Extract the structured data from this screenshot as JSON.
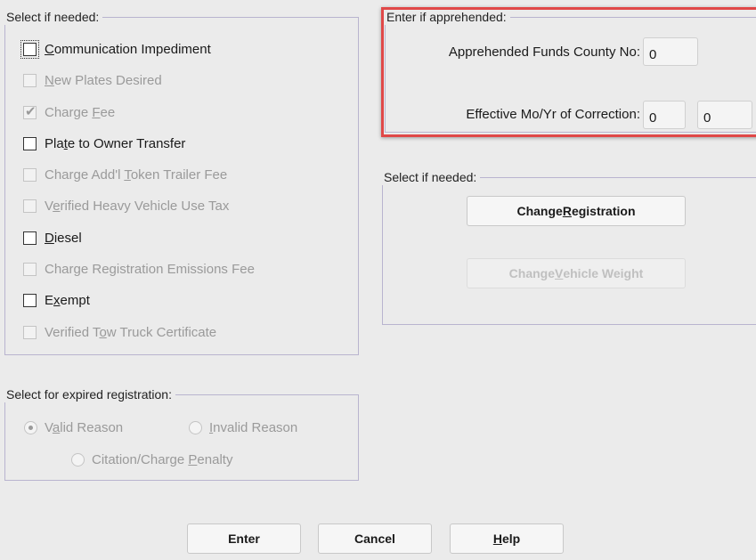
{
  "select_group": {
    "legend": "Select if needed:",
    "items": [
      {
        "pre": "",
        "mn": "C",
        "post": "ommunication Impediment",
        "checked": false,
        "disabled": false
      },
      {
        "pre": "",
        "mn": "N",
        "post": "ew Plates Desired",
        "checked": false,
        "disabled": true
      },
      {
        "pre": "Charge ",
        "mn": "F",
        "post": "ee",
        "checked": true,
        "disabled": true
      },
      {
        "pre": "Pla",
        "mn": "t",
        "post": "e to Owner Transfer",
        "checked": false,
        "disabled": false
      },
      {
        "pre": "Charge Add'l ",
        "mn": "T",
        "post": "oken Trailer Fee",
        "checked": false,
        "disabled": true
      },
      {
        "pre": "V",
        "mn": "e",
        "post": "rified Heavy Vehicle Use Tax",
        "checked": false,
        "disabled": true
      },
      {
        "pre": "",
        "mn": "D",
        "post": "iesel",
        "checked": false,
        "disabled": false
      },
      {
        "pre": "Char",
        "mn": "g",
        "post": "e Registration Emissions Fee",
        "checked": false,
        "disabled": true
      },
      {
        "pre": "E",
        "mn": "x",
        "post": "empt",
        "checked": false,
        "disabled": false
      },
      {
        "pre": "Verified T",
        "mn": "o",
        "post": "w Truck Certificate",
        "checked": false,
        "disabled": true
      }
    ]
  },
  "apprehended_group": {
    "legend": "Enter if apprehended:",
    "county_label": "Apprehended Funds County No:",
    "county_value": "0",
    "effective_label": "Effective Mo/Yr of Correction:",
    "effective_month": "0",
    "effective_year": "0"
  },
  "select_group2": {
    "legend": "Select if needed:",
    "change_registration": {
      "pre": "Change ",
      "mn": "R",
      "post": "egistration"
    },
    "change_weight": {
      "pre": "Change ",
      "mn": "V",
      "post": "ehicle Weight"
    }
  },
  "expired_group": {
    "legend": "Select for expired registration:",
    "valid": {
      "pre": "V",
      "mn": "a",
      "post": "lid Reason",
      "selected": true
    },
    "invalid": {
      "pre": "",
      "mn": "I",
      "post": "nvalid Reason",
      "selected": false
    },
    "citation": {
      "pre": "Citation/Charge ",
      "mn": "P",
      "post": "enalty",
      "selected": false
    }
  },
  "footer": {
    "enter": "Enter",
    "cancel": "Cancel",
    "help": {
      "pre": "",
      "mn": "H",
      "post": "elp"
    }
  }
}
